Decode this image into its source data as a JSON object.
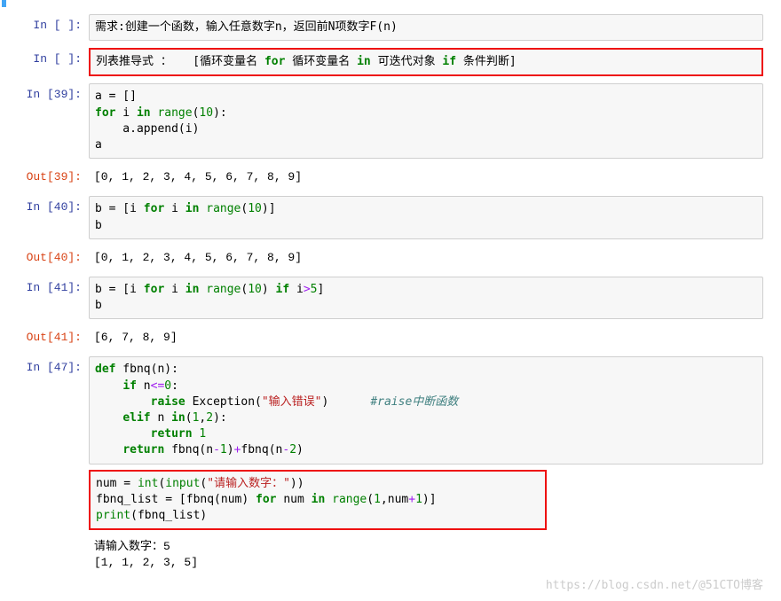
{
  "cells": [
    {
      "id": "c1",
      "type": "in",
      "prompt_num": "",
      "highlight": false,
      "segments": [
        {
          "t": "需求:创建一个函数，输入任意数字n，返回前N项数字F(n)",
          "c": "cnword"
        }
      ]
    },
    {
      "id": "c2",
      "type": "in",
      "prompt_num": "",
      "highlight": true,
      "segments": [
        {
          "t": "列表推导式 ：   [循环变量名 ",
          "c": ""
        },
        {
          "t": "for",
          "c": "kw"
        },
        {
          "t": " 循环变量名 ",
          "c": ""
        },
        {
          "t": "in",
          "c": "kw"
        },
        {
          "t": " 可迭代对象 ",
          "c": ""
        },
        {
          "t": "if",
          "c": "kw"
        },
        {
          "t": " 条件判断]",
          "c": ""
        }
      ]
    },
    {
      "id": "c3",
      "type": "in",
      "prompt_num": "39",
      "highlight": false,
      "lines": [
        [
          {
            "t": "a = []",
            "c": ""
          }
        ],
        [
          {
            "t": "for",
            "c": "kw"
          },
          {
            "t": " i ",
            "c": ""
          },
          {
            "t": "in",
            "c": "kw"
          },
          {
            "t": " ",
            "c": ""
          },
          {
            "t": "range",
            "c": "fn"
          },
          {
            "t": "(",
            "c": ""
          },
          {
            "t": "10",
            "c": "num"
          },
          {
            "t": "):",
            "c": ""
          }
        ],
        [
          {
            "t": "    a.append(i)",
            "c": ""
          }
        ],
        [
          {
            "t": "a",
            "c": ""
          }
        ]
      ]
    },
    {
      "id": "c3o",
      "type": "out",
      "prompt_num": "39",
      "text": "[0, 1, 2, 3, 4, 5, 6, 7, 8, 9]"
    },
    {
      "id": "c4",
      "type": "in",
      "prompt_num": "40",
      "highlight": false,
      "lines": [
        [
          {
            "t": "b = [i ",
            "c": ""
          },
          {
            "t": "for",
            "c": "kw"
          },
          {
            "t": " i ",
            "c": ""
          },
          {
            "t": "in",
            "c": "kw"
          },
          {
            "t": " ",
            "c": ""
          },
          {
            "t": "range",
            "c": "fn"
          },
          {
            "t": "(",
            "c": ""
          },
          {
            "t": "10",
            "c": "num"
          },
          {
            "t": ")]",
            "c": ""
          }
        ],
        [
          {
            "t": "b",
            "c": ""
          }
        ]
      ]
    },
    {
      "id": "c4o",
      "type": "out",
      "prompt_num": "40",
      "text": "[0, 1, 2, 3, 4, 5, 6, 7, 8, 9]"
    },
    {
      "id": "c5",
      "type": "in",
      "prompt_num": "41",
      "highlight": false,
      "lines": [
        [
          {
            "t": "b = [i ",
            "c": ""
          },
          {
            "t": "for",
            "c": "kw"
          },
          {
            "t": " i ",
            "c": ""
          },
          {
            "t": "in",
            "c": "kw"
          },
          {
            "t": " ",
            "c": ""
          },
          {
            "t": "range",
            "c": "fn"
          },
          {
            "t": "(",
            "c": ""
          },
          {
            "t": "10",
            "c": "num"
          },
          {
            "t": ") ",
            "c": ""
          },
          {
            "t": "if",
            "c": "kw"
          },
          {
            "t": " i",
            "c": ""
          },
          {
            "t": ">",
            "c": "op"
          },
          {
            "t": "5",
            "c": "num"
          },
          {
            "t": "]",
            "c": ""
          }
        ],
        [
          {
            "t": "b",
            "c": ""
          }
        ]
      ]
    },
    {
      "id": "c5o",
      "type": "out",
      "prompt_num": "41",
      "text": "[6, 7, 8, 9]"
    },
    {
      "id": "c6",
      "type": "in",
      "prompt_num": "47",
      "highlight": false,
      "lines": [
        [
          {
            "t": "def",
            "c": "kw"
          },
          {
            "t": " fbnq(n):",
            "c": ""
          }
        ],
        [
          {
            "t": "    ",
            "c": ""
          },
          {
            "t": "if",
            "c": "kw"
          },
          {
            "t": " n",
            "c": ""
          },
          {
            "t": "<=",
            "c": "op"
          },
          {
            "t": "0",
            "c": "num"
          },
          {
            "t": ":",
            "c": ""
          }
        ],
        [
          {
            "t": "        ",
            "c": ""
          },
          {
            "t": "raise",
            "c": "kw"
          },
          {
            "t": " Exception(",
            "c": ""
          },
          {
            "t": "\"输入错误\"",
            "c": "str"
          },
          {
            "t": ")      ",
            "c": ""
          },
          {
            "t": "#raise中断函数",
            "c": "comment"
          }
        ],
        [
          {
            "t": "    ",
            "c": ""
          },
          {
            "t": "elif",
            "c": "kw"
          },
          {
            "t": " n ",
            "c": ""
          },
          {
            "t": "in",
            "c": "kw"
          },
          {
            "t": "(",
            "c": ""
          },
          {
            "t": "1",
            "c": "num"
          },
          {
            "t": ",",
            "c": ""
          },
          {
            "t": "2",
            "c": "num"
          },
          {
            "t": "):",
            "c": ""
          }
        ],
        [
          {
            "t": "        ",
            "c": ""
          },
          {
            "t": "return",
            "c": "kw"
          },
          {
            "t": " ",
            "c": ""
          },
          {
            "t": "1",
            "c": "num"
          }
        ],
        [
          {
            "t": "    ",
            "c": ""
          },
          {
            "t": "return",
            "c": "kw"
          },
          {
            "t": " fbnq(n",
            "c": ""
          },
          {
            "t": "-",
            "c": "op"
          },
          {
            "t": "1",
            "c": "num"
          },
          {
            "t": ")",
            "c": ""
          },
          {
            "t": "+",
            "c": "op"
          },
          {
            "t": "fbnq(n",
            "c": ""
          },
          {
            "t": "-",
            "c": "op"
          },
          {
            "t": "2",
            "c": "num"
          },
          {
            "t": ")",
            "c": ""
          }
        ]
      ],
      "sub": {
        "highlight": true,
        "lines": [
          [
            {
              "t": "num = ",
              "c": ""
            },
            {
              "t": "int",
              "c": "fn"
            },
            {
              "t": "(",
              "c": ""
            },
            {
              "t": "input",
              "c": "fn"
            },
            {
              "t": "(",
              "c": ""
            },
            {
              "t": "\"请输入数字：\"",
              "c": "str"
            },
            {
              "t": "))",
              "c": ""
            }
          ],
          [
            {
              "t": "fbnq_list = [fbnq(num) ",
              "c": ""
            },
            {
              "t": "for",
              "c": "kw"
            },
            {
              "t": " num ",
              "c": ""
            },
            {
              "t": "in",
              "c": "kw"
            },
            {
              "t": " ",
              "c": ""
            },
            {
              "t": "range",
              "c": "fn"
            },
            {
              "t": "(",
              "c": ""
            },
            {
              "t": "1",
              "c": "num"
            },
            {
              "t": ",num",
              "c": ""
            },
            {
              "t": "+",
              "c": "op"
            },
            {
              "t": "1",
              "c": "num"
            },
            {
              "t": ")]",
              "c": ""
            }
          ],
          [
            {
              "t": "print",
              "c": "fn"
            },
            {
              "t": "(fbnq_list)",
              "c": ""
            }
          ]
        ]
      },
      "stdout": [
        "请输入数字：5",
        "[1, 1, 2, 3, 5]"
      ]
    }
  ],
  "watermark": "https://blog.csdn.net/@51CTO博客"
}
